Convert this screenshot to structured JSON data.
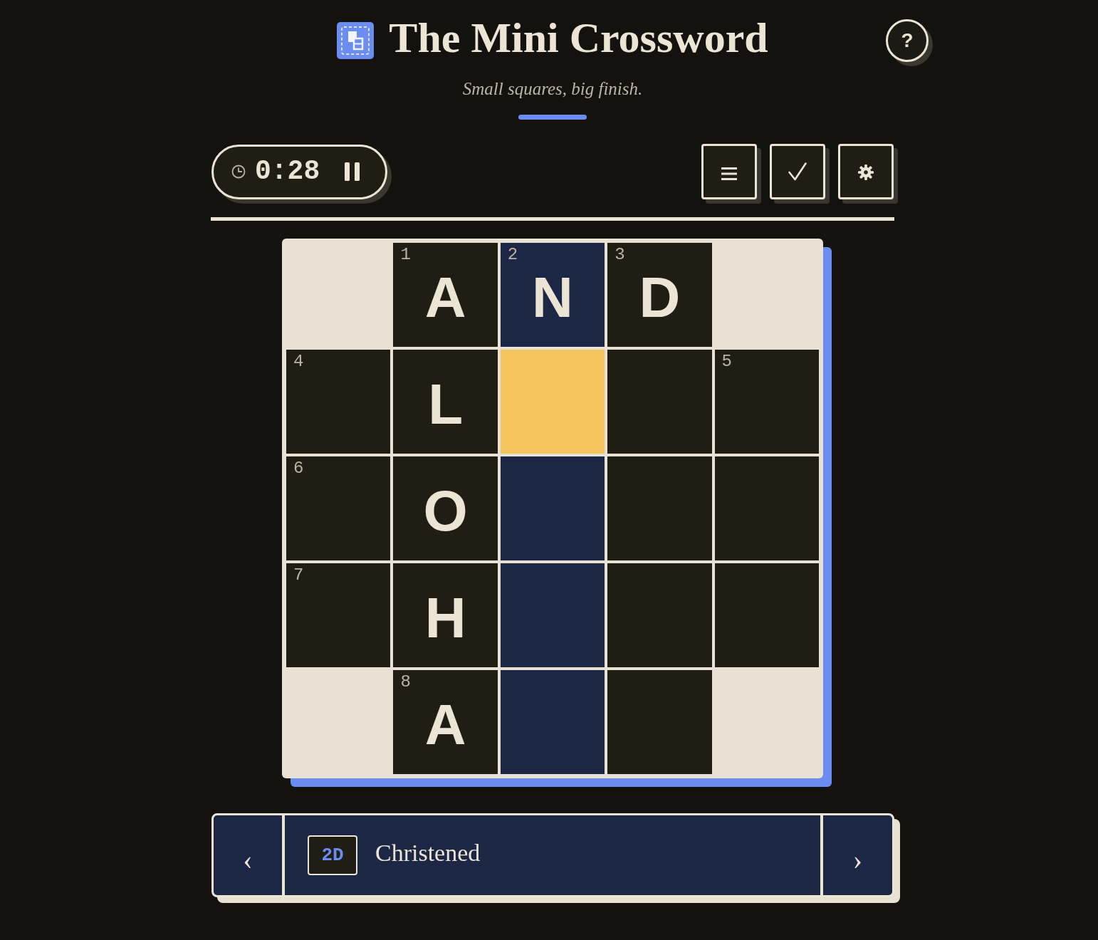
{
  "header": {
    "title": "The Mini Crossword",
    "subtitle": "Small squares, big finish.",
    "help": "?"
  },
  "timer": {
    "time": "0:28",
    "running": true
  },
  "grid": {
    "rows": [
      [
        {
          "kind": "block"
        },
        {
          "kind": "square",
          "number": "1",
          "letter": "A",
          "selected": false,
          "highlighted": false
        },
        {
          "kind": "square",
          "number": "2",
          "letter": "N",
          "selected": false,
          "highlighted": true
        },
        {
          "kind": "square",
          "number": "3",
          "letter": "D",
          "selected": false,
          "highlighted": false
        },
        {
          "kind": "block"
        }
      ],
      [
        {
          "kind": "square",
          "number": "4",
          "selected": false,
          "highlighted": false
        },
        {
          "kind": "square",
          "letter": "L",
          "selected": false,
          "highlighted": false
        },
        {
          "kind": "square",
          "selected": true,
          "highlighted": true
        },
        {
          "kind": "square",
          "selected": false,
          "highlighted": false
        },
        {
          "kind": "square",
          "number": "5",
          "selected": false,
          "highlighted": false
        }
      ],
      [
        {
          "kind": "square",
          "number": "6",
          "selected": false,
          "highlighted": false
        },
        {
          "kind": "square",
          "letter": "O",
          "selected": false,
          "highlighted": false
        },
        {
          "kind": "square",
          "selected": false,
          "highlighted": true
        },
        {
          "kind": "square",
          "selected": false,
          "highlighted": false
        },
        {
          "kind": "square",
          "selected": false,
          "highlighted": false
        }
      ],
      [
        {
          "kind": "square",
          "number": "7",
          "selected": false,
          "highlighted": false
        },
        {
          "kind": "square",
          "letter": "H",
          "selected": false,
          "highlighted": false
        },
        {
          "kind": "square",
          "selected": false,
          "highlighted": true
        },
        {
          "kind": "square",
          "selected": false,
          "highlighted": false
        },
        {
          "kind": "square",
          "selected": false,
          "highlighted": false
        }
      ],
      [
        {
          "kind": "block"
        },
        {
          "kind": "square",
          "number": "8",
          "letter": "A",
          "selected": false,
          "highlighted": false
        },
        {
          "kind": "square",
          "selected": false,
          "highlighted": true
        },
        {
          "kind": "square",
          "selected": false,
          "highlighted": false
        },
        {
          "kind": "block"
        }
      ]
    ]
  },
  "clue_bar": {
    "previous": "‹",
    "label": "2D",
    "text": "Christened",
    "next": "›"
  }
}
